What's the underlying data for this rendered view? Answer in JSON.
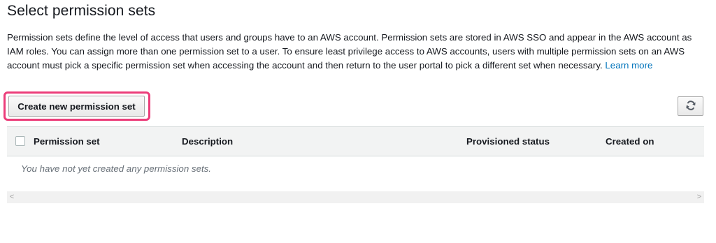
{
  "title": "Select permission sets",
  "description": "Permission sets define the level of access that users and groups have to an AWS account. Permission sets are stored in AWS SSO and appear in the AWS account as IAM roles. You can assign more than one permission set to a user. To ensure least privilege access to AWS accounts, users with multiple permission sets on an AWS account must pick a specific permission set when accessing the account and then return to the user portal to pick a different set when necessary.",
  "learn_more": "Learn more",
  "toolbar": {
    "create_label": "Create new permission set",
    "refresh_icon": "refresh-icon"
  },
  "table": {
    "columns": [
      "Permission set",
      "Description",
      "Provisioned status",
      "Created on"
    ],
    "empty_message": "You have not yet created any permission sets."
  },
  "scrollbar": {
    "left_arrow": "<",
    "right_arrow": ">"
  },
  "colors": {
    "link": "#0073bb",
    "highlight": "#ec3d7a",
    "header_bg": "#f2f3f3"
  }
}
